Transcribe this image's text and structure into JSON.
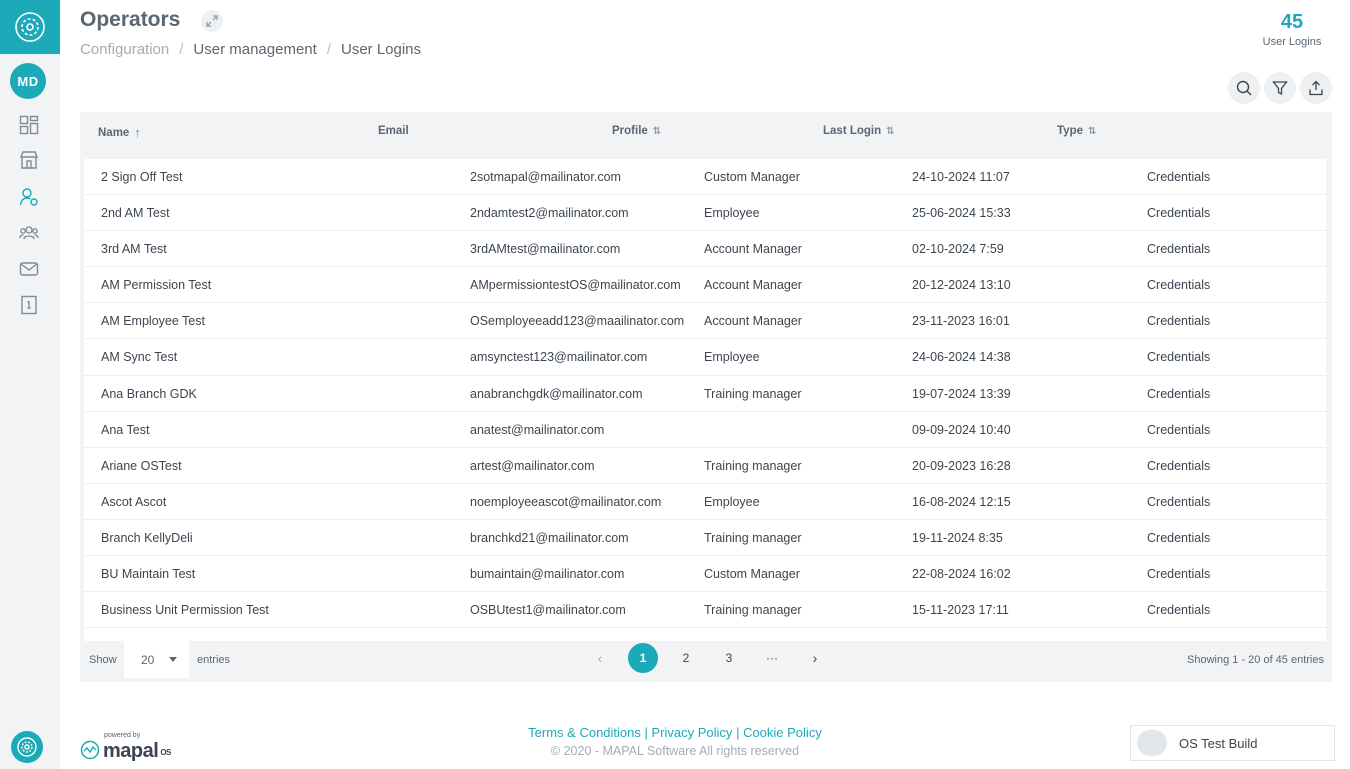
{
  "header": {
    "title": "Operators",
    "breadcrumb": [
      "Configuration",
      "User management",
      "User Logins"
    ],
    "stat_value": "45",
    "stat_label": "User Logins"
  },
  "sidebar": {
    "avatar_initials": "MD",
    "items": [
      "dashboard-icon",
      "store-icon",
      "user-settings-icon",
      "team-icon",
      "mail-icon",
      "info-book-icon"
    ]
  },
  "toolbar": {
    "icons": [
      "search-icon",
      "filter-icon",
      "export-icon"
    ]
  },
  "table": {
    "columns": [
      "Name",
      "Email",
      "Profile",
      "Last Login",
      "Type"
    ],
    "rows": [
      [
        "2 Sign Off Test",
        "2sotmapal@mailinator.com",
        "Custom Manager",
        "24-10-2024 11:07",
        "Credentials"
      ],
      [
        "2nd AM Test",
        "2ndamtest2@mailinator.com",
        "Employee",
        "25-06-2024 15:33",
        "Credentials"
      ],
      [
        "3rd AM Test",
        "3rdAMtest@mailinator.com",
        "Account Manager",
        "02-10-2024 7:59",
        "Credentials"
      ],
      [
        "AM Permission Test",
        "AMpermissiontestOS@mailinator.com",
        "Account Manager",
        "20-12-2024 13:10",
        "Credentials"
      ],
      [
        "AM Employee Test",
        "OSemployeeadd123@maailinator.com",
        "Account Manager",
        "23-11-2023 16:01",
        "Credentials"
      ],
      [
        "AM Sync Test",
        "amsynctest123@mailinator.com",
        "Employee",
        "24-06-2024 14:38",
        "Credentials"
      ],
      [
        "Ana Branch GDK",
        "anabranchgdk@mailinator.com",
        "Training manager",
        "19-07-2024 13:39",
        "Credentials"
      ],
      [
        "Ana Test",
        "anatest@mailinator.com",
        "",
        "09-09-2024 10:40",
        "Credentials"
      ],
      [
        "Ariane OSTest",
        "artest@mailinator.com",
        "Training manager",
        "20-09-2023 16:28",
        "Credentials"
      ],
      [
        "Ascot Ascot",
        "noemployeeascot@mailinator.com",
        "Employee",
        "16-08-2024 12:15",
        "Credentials"
      ],
      [
        "Branch KellyDeli",
        "branchkd21@mailinator.com",
        "Training manager",
        "19-11-2024 8:35",
        "Credentials"
      ],
      [
        "BU Maintain Test",
        "bumaintain@mailinator.com",
        "Custom Manager",
        "22-08-2024 16:02",
        "Credentials"
      ],
      [
        "Business Unit Permission Test",
        "OSBUtest1@mailinator.com",
        "Training manager",
        "15-11-2023 17:11",
        "Credentials"
      ]
    ]
  },
  "pagination": {
    "show_label": "Show",
    "entries_value": "20",
    "entries_label": "entries",
    "pages": [
      "1",
      "2",
      "3",
      "···"
    ],
    "prev": "‹",
    "next": "›",
    "showing": "Showing 1 - 20 of 45 entries"
  },
  "footer": {
    "powered_by": "powered by",
    "brand": "mapal",
    "brand_suffix": "OS",
    "links": [
      "Terms & Conditions",
      "Privacy Policy",
      "Cookie Policy"
    ],
    "copyright": "© 2020 - MAPAL Software All rights reserved",
    "build": "OS Test Build"
  },
  "colors": {
    "accent": "#1ca9b8",
    "panel": "#f2f3f5",
    "text": "#3c4650"
  }
}
